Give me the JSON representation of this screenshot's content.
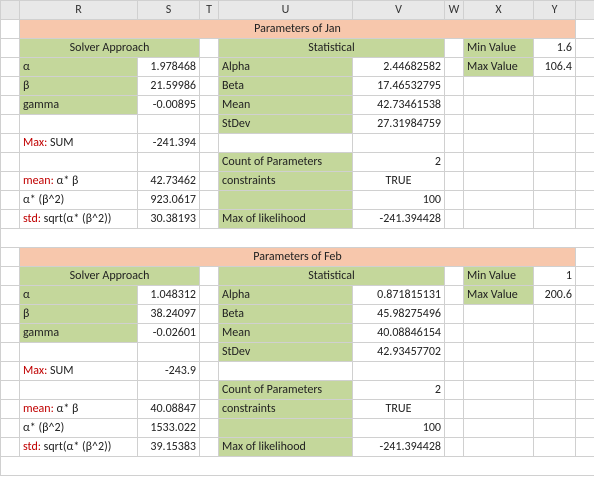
{
  "columns": {
    "r": "R",
    "s": "S",
    "t": "T",
    "u": "U",
    "v": "V",
    "w": "W",
    "x": "X",
    "y": "Y"
  },
  "jan": {
    "title": "Parameters of Jan",
    "solver_header": "Solver Approach",
    "stat_header": "Statistical",
    "alpha_lbl": "α",
    "alpha_val": "1.978468",
    "beta_lbl": "β",
    "beta_val": "21.59986",
    "gamma_lbl": "gamma",
    "gamma_val": "-0.00895",
    "max_lbl_red": "Max:",
    "max_lbl_rest": " SUM",
    "max_val": "-241.394",
    "mean_lbl_red": "mean:",
    "mean_lbl_rest": " α* β",
    "mean_val": "42.73462",
    "ab2_lbl": "α* (β^2)",
    "ab2_val": "923.0617",
    "std_lbl_red": "std:",
    "std_lbl_rest": " sqrt(α* (β^2))",
    "std_val": "30.38193",
    "stat_alpha_lbl": "Alpha",
    "stat_alpha_val": "2.44682582",
    "stat_beta_lbl": "Beta",
    "stat_beta_val": "17.46532795",
    "stat_mean_lbl": "Mean",
    "stat_mean_val": "42.73461538",
    "stat_std_lbl": "StDev",
    "stat_std_val": "27.31984759",
    "count_lbl": "Count of Parameters",
    "count_val": "2",
    "constraints_lbl": "constraints",
    "constraints_val": "TRUE",
    "blank_val": "100",
    "maxlik_lbl": "Max of likelihood",
    "maxlik_val": "-241.394428",
    "min_lbl": "Min Value",
    "min_val": "1.6",
    "max_lbl2": "Max Value",
    "max_val2": "106.4"
  },
  "feb": {
    "title": "Parameters of Feb",
    "solver_header": "Solver Approach",
    "stat_header": "Statistical",
    "alpha_lbl": "α",
    "alpha_val": "1.048312",
    "beta_lbl": "β",
    "beta_val": "38.24097",
    "gamma_lbl": "gamma",
    "gamma_val": "-0.02601",
    "max_lbl_red": "Max:",
    "max_lbl_rest": " SUM",
    "max_val": "-243.9",
    "mean_lbl_red": "mean:",
    "mean_lbl_rest": " α* β",
    "mean_val": "40.08847",
    "ab2_lbl": "α* (β^2)",
    "ab2_val": "1533.022",
    "std_lbl_red": "std:",
    "std_lbl_rest": " sqrt(α* (β^2))",
    "std_val": "39.15383",
    "stat_alpha_lbl": "Alpha",
    "stat_alpha_val": "0.871815131",
    "stat_beta_lbl": "Beta",
    "stat_beta_val": "45.98275496",
    "stat_mean_lbl": "Mean",
    "stat_mean_val": "40.08846154",
    "stat_std_lbl": "StDev",
    "stat_std_val": "42.93457702",
    "count_lbl": "Count of Parameters",
    "count_val": "2",
    "constraints_lbl": "constraints",
    "constraints_val": "TRUE",
    "blank_val": "100",
    "maxlik_lbl": "Max of likelihood",
    "maxlik_val": "-241.394428",
    "min_lbl": "Min Value",
    "min_val": "1",
    "max_lbl2": "Max Value",
    "max_val2": "200.6"
  }
}
